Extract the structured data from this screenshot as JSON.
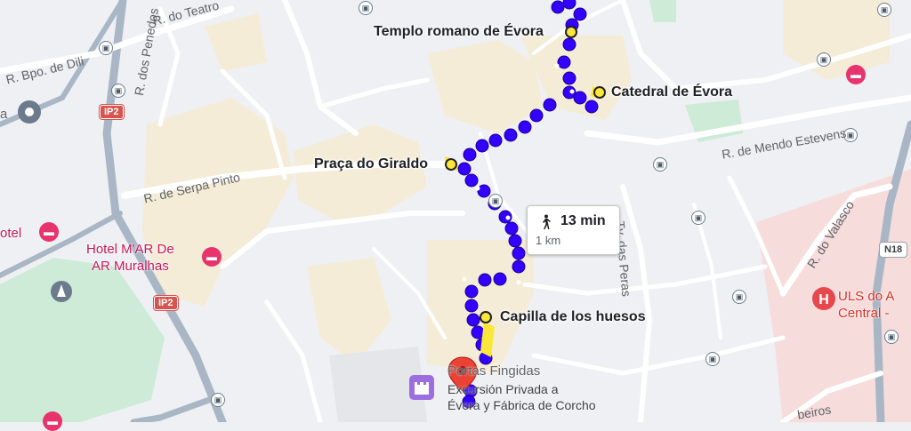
{
  "map": {
    "route_color": "#3300ff",
    "stop_color": "#fbe73a",
    "block_color": "#f5ecd7",
    "park_color": "#cdebd6",
    "hospital_area_color": "#f7dcdc",
    "road_color": "#ffffff",
    "highway_color": "#a9b6c5"
  },
  "route": {
    "time": "13 min",
    "distance": "1 km",
    "mode_icon": "walking-person-icon"
  },
  "stops": {
    "templo": "Templo romano de Évora",
    "catedral": "Catedral de Évora",
    "giraldo": "Praça do Giraldo",
    "capilla": "Capilla de los huesos"
  },
  "streets": {
    "teatro": "R. do Teatro",
    "dili": "R. Bpo. de Dili",
    "penedos": "R. dos Penedos",
    "serpa": "R. de Serpa Pinto",
    "mendo": "R. de Mendo Estevens",
    "peras": "Tv. das Peras",
    "valasco": "R. do Valasco",
    "ribeiros": "beiros"
  },
  "road_shields": {
    "ip2_top": "IP2",
    "ip2_bottom": "IP2",
    "n18": "N18"
  },
  "pois": {
    "hotel_left": "otel",
    "hotel_mar": "Hotel M'AR De\nAR Muralhas",
    "uls": "ULS do A\nCentral -",
    "portas": "Portas Fingidas",
    "excursion": "Excursión Privada a\nÉvora y Fábrica de Corcho",
    "left_a": "a"
  },
  "icons": {
    "bus": "bus-stop-icon",
    "hotel": "hotel-bed-icon",
    "hospital": "hospital-icon",
    "pin": "map-pin-icon",
    "tour": "castle-tour-icon",
    "monument": "monument-icon",
    "location": "location-marker-icon"
  }
}
